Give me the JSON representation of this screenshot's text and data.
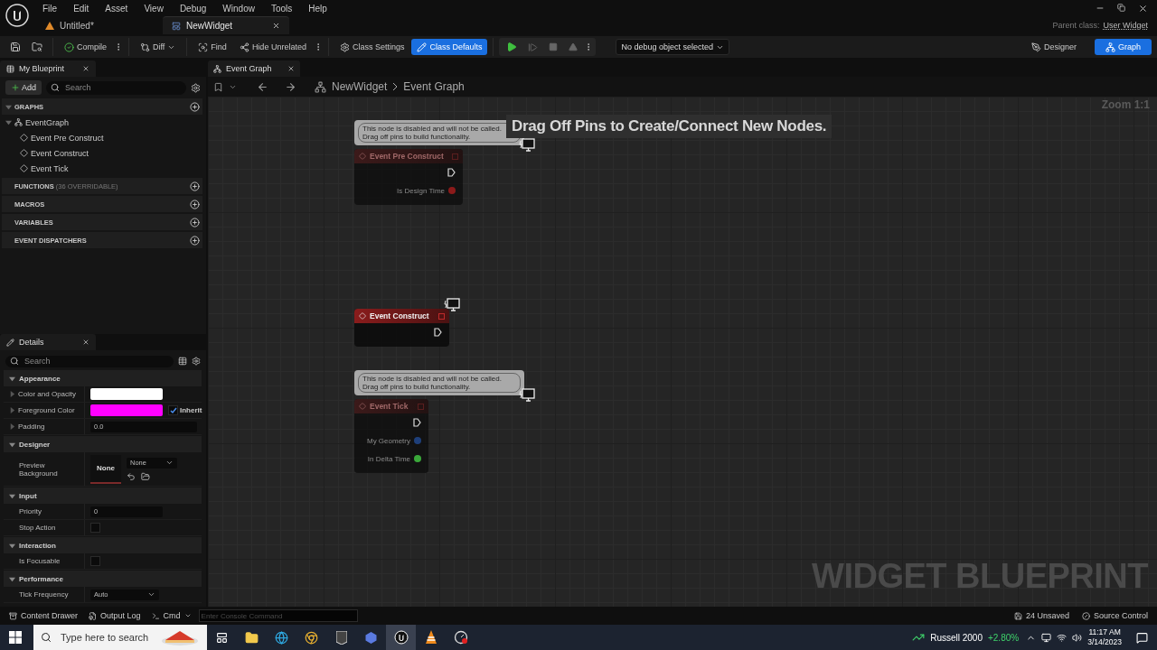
{
  "menu": [
    "File",
    "Edit",
    "Asset",
    "View",
    "Debug",
    "Window",
    "Tools",
    "Help"
  ],
  "doc_tabs": [
    {
      "label": "Untitled*",
      "selected": false
    },
    {
      "label": "NewWidget",
      "selected": true
    }
  ],
  "parent_class": {
    "label": "Parent class:",
    "value": "User Widget"
  },
  "toolbar": {
    "buttons": [
      {
        "label": "Compile",
        "selected": false
      },
      {
        "label": "Diff",
        "selected": false
      },
      {
        "label": "Find",
        "selected": false
      },
      {
        "label": "Hide Unrelated",
        "selected": false
      },
      {
        "label": "Class Settings",
        "selected": false
      },
      {
        "label": "Class Defaults",
        "selected": true
      }
    ],
    "debug_select": "No debug object selected",
    "modes": [
      {
        "label": "Designer",
        "selected": false
      },
      {
        "label": "Graph",
        "selected": true
      }
    ]
  },
  "my_blueprint": {
    "tab": "My Blueprint",
    "add": "Add",
    "search_placeholder": "Search",
    "sections": [
      {
        "title": "GRAPHS",
        "expanded": true,
        "children": [
          {
            "label": "EventGraph",
            "expanded": true,
            "children": [
              {
                "label": "Event Pre Construct"
              },
              {
                "label": "Event Construct"
              },
              {
                "label": "Event Tick"
              }
            ]
          }
        ]
      },
      {
        "title": "FUNCTIONS",
        "note": "(36 OVERRIDABLE)",
        "expanded": false
      },
      {
        "title": "MACROS",
        "expanded": false
      },
      {
        "title": "VARIABLES",
        "expanded": false
      },
      {
        "title": "EVENT DISPATCHERS",
        "expanded": false
      }
    ]
  },
  "details": {
    "tab": "Details",
    "search_placeholder": "Search",
    "categories": [
      {
        "title": "Appearance",
        "expanded": true,
        "rows": [
          {
            "kind": "color",
            "label": "Color and Opacity",
            "expanded": false,
            "color": "#ffffff"
          },
          {
            "kind": "color",
            "label": "Foreground Color",
            "expanded": false,
            "color": "#ff00ff",
            "inherit": {
              "label": "Inherit",
              "checked": true
            }
          },
          {
            "kind": "text",
            "label": "Padding",
            "expanded": false,
            "value": "0.0"
          }
        ]
      },
      {
        "title": "Designer",
        "expanded": true,
        "rows": [
          {
            "kind": "preview",
            "label": "Preview Background",
            "swatch": "None",
            "value": "None"
          }
        ]
      },
      {
        "title": "Input",
        "expanded": true,
        "rows": [
          {
            "kind": "text",
            "label": "Priority",
            "value": "0"
          },
          {
            "kind": "checkbox",
            "label": "Stop Action",
            "checked": false
          }
        ]
      },
      {
        "title": "Interaction",
        "expanded": true,
        "rows": [
          {
            "kind": "checkbox",
            "label": "Is Focusable",
            "checked": false
          }
        ]
      },
      {
        "title": "Performance",
        "expanded": true,
        "rows": [
          {
            "kind": "dropdown",
            "label": "Tick Frequency",
            "value": "Auto"
          }
        ]
      }
    ]
  },
  "graph": {
    "tab": "Event Graph",
    "breadcrumb": [
      "NewWidget",
      "Event Graph"
    ],
    "zoom": "Zoom 1:1",
    "hint": "Drag Off Pins to Create/Connect New Nodes.",
    "watermark": "WIDGET BLUEPRINT",
    "nodes": [
      {
        "title": "Event Pre Construct",
        "disabled": true,
        "comment": [
          "This node is disabled and will not be called.",
          "Drag off pins to build functionality."
        ],
        "pins": [
          {
            "kind": "exec"
          },
          {
            "kind": "data",
            "label": "Is Design Time",
            "color": "#8b1a1a"
          }
        ]
      },
      {
        "title": "Event Construct",
        "disabled": false,
        "pins": [
          {
            "kind": "exec"
          }
        ]
      },
      {
        "title": "Event Tick",
        "disabled": true,
        "comment": [
          "This node is disabled and will not be called.",
          "Drag off pins to build functionality."
        ],
        "pins": [
          {
            "kind": "exec"
          },
          {
            "kind": "data",
            "label": "My Geometry",
            "color": "#1e3f7a"
          },
          {
            "kind": "data",
            "label": "In Delta Time",
            "color": "#3aa83a"
          }
        ]
      }
    ]
  },
  "status_bar": {
    "left": [
      "Content Drawer",
      "Output Log",
      "Cmd"
    ],
    "console_placeholder": "Enter Console Command",
    "right": [
      "24 Unsaved",
      "Source Control"
    ]
  },
  "taskbar": {
    "search_placeholder": "Type here to search",
    "stock": {
      "name": "Russell 2000",
      "change": "+2.80%"
    },
    "time": "11:17 AM",
    "date": "3/14/2023"
  }
}
